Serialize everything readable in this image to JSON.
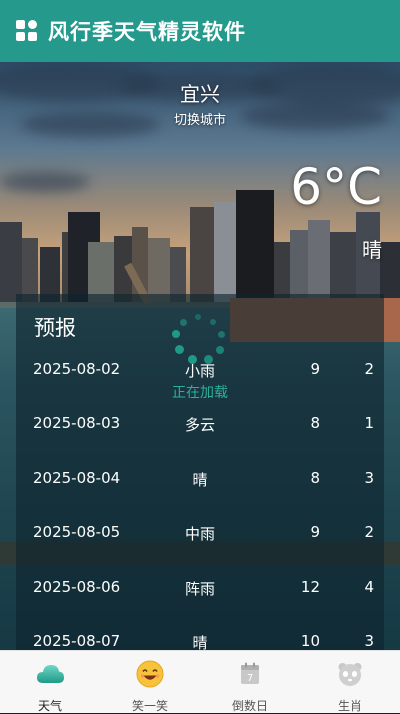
{
  "app": {
    "title": "风行季天气精灵软件"
  },
  "weather": {
    "city": "宜兴",
    "switch_city": "切换城市",
    "temperature": "6°C",
    "condition": "晴"
  },
  "forecast": {
    "title": "预报",
    "loading": "正在加载",
    "rows": [
      {
        "date": "2025-08-02",
        "cond": "小雨",
        "hi": "9",
        "lo": "2"
      },
      {
        "date": "2025-08-03",
        "cond": "多云",
        "hi": "8",
        "lo": "1"
      },
      {
        "date": "2025-08-04",
        "cond": "晴",
        "hi": "8",
        "lo": "3"
      },
      {
        "date": "2025-08-05",
        "cond": "中雨",
        "hi": "9",
        "lo": "2"
      },
      {
        "date": "2025-08-06",
        "cond": "阵雨",
        "hi": "12",
        "lo": "4"
      },
      {
        "date": "2025-08-07",
        "cond": "晴",
        "hi": "10",
        "lo": "3"
      }
    ]
  },
  "tabs": [
    {
      "label": "天气",
      "icon": "cloud-icon"
    },
    {
      "label": "笑一笑",
      "icon": "smiley-icon"
    },
    {
      "label": "倒数日",
      "icon": "calendar-icon",
      "day_number": "7"
    },
    {
      "label": "生肖",
      "icon": "zodiac-icon"
    }
  ],
  "colors": {
    "primary": "#259a8c",
    "loader": "#1f9a87"
  }
}
